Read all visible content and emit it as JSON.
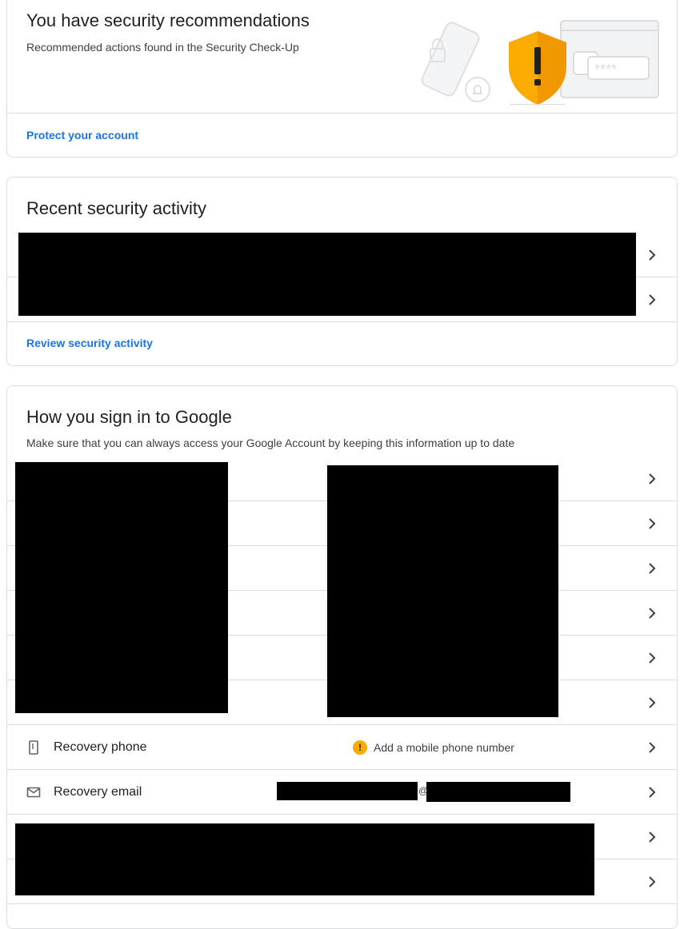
{
  "recommendations": {
    "title": "You have security recommendations",
    "subtitle": "Recommended actions found in the Security Check-Up",
    "link": "Protect your account",
    "accent_color": "#f9ab00"
  },
  "recent_activity": {
    "title": "Recent security activity",
    "link": "Review security activity"
  },
  "sign_in": {
    "title": "How you sign in to Google",
    "subtitle": "Make sure that you can always access your Google Account by keeping this information up to date",
    "recovery_phone_label": "Recovery phone",
    "recovery_phone_value": "Add a mobile phone number",
    "recovery_email_label": "Recovery email",
    "email_at": "@"
  },
  "colors": {
    "link": "#1a73e8",
    "border": "#dadce0",
    "warning": "#f9ab00"
  }
}
